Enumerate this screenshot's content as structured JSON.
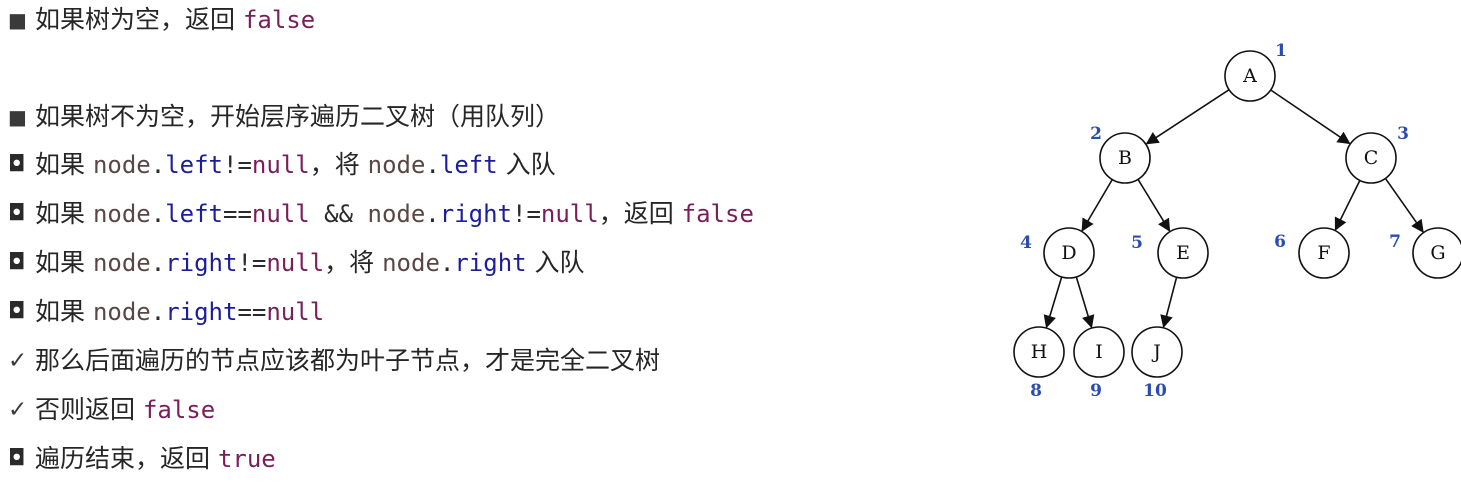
{
  "lines": [
    {
      "bullet": "■",
      "segments": [
        {
          "t": "如果树为空，返回 "
        },
        {
          "t": "false"
        }
      ]
    },
    {
      "bullet": "■",
      "segments": [
        {
          "t": "如果树不为空，开始层序遍历二叉树（用队列）"
        }
      ]
    },
    {
      "bullet": "◘",
      "segments": [
        {
          "t": "如果 "
        },
        {
          "t": "node"
        },
        {
          "t": "."
        },
        {
          "t": "left"
        },
        {
          "t": "!="
        },
        {
          "t": "null"
        },
        {
          "t": "，将 "
        },
        {
          "t": "node"
        },
        {
          "t": "."
        },
        {
          "t": "left"
        },
        {
          "t": " 入队"
        }
      ]
    },
    {
      "bullet": "◘",
      "segments": [
        {
          "t": "如果 "
        },
        {
          "t": "node"
        },
        {
          "t": "."
        },
        {
          "t": "left"
        },
        {
          "t": "=="
        },
        {
          "t": "null"
        },
        {
          "t": " && "
        },
        {
          "t": "node"
        },
        {
          "t": "."
        },
        {
          "t": "right"
        },
        {
          "t": "!="
        },
        {
          "t": "null"
        },
        {
          "t": "，返回 "
        },
        {
          "t": "false"
        }
      ]
    },
    {
      "bullet": "◘",
      "segments": [
        {
          "t": "如果 "
        },
        {
          "t": "node"
        },
        {
          "t": "."
        },
        {
          "t": "right"
        },
        {
          "t": "!="
        },
        {
          "t": "null"
        },
        {
          "t": "，将 "
        },
        {
          "t": "node"
        },
        {
          "t": "."
        },
        {
          "t": "right"
        },
        {
          "t": " 入队"
        }
      ]
    },
    {
      "bullet": "◘",
      "segments": [
        {
          "t": "如果 "
        },
        {
          "t": "node"
        },
        {
          "t": "."
        },
        {
          "t": "right"
        },
        {
          "t": "=="
        },
        {
          "t": "null"
        }
      ]
    },
    {
      "bullet": "✓",
      "segments": [
        {
          "t": "那么后面遍历的节点应该都为叶子节点，才是完全二叉树"
        }
      ]
    },
    {
      "bullet": "✓",
      "segments": [
        {
          "t": "否则返回 "
        },
        {
          "t": "false"
        }
      ]
    },
    {
      "bullet": "◘",
      "segments": [
        {
          "t": "遍历结束，返回 "
        },
        {
          "t": "true"
        }
      ]
    }
  ],
  "tree": {
    "nodes": [
      {
        "label": "A",
        "index": "1"
      },
      {
        "label": "B",
        "index": "2"
      },
      {
        "label": "C",
        "index": "3"
      },
      {
        "label": "D",
        "index": "4"
      },
      {
        "label": "E",
        "index": "5"
      },
      {
        "label": "F",
        "index": "6"
      },
      {
        "label": "G",
        "index": "7"
      },
      {
        "label": "H",
        "index": "8"
      },
      {
        "label": "I",
        "index": "9"
      },
      {
        "label": "J",
        "index": "10"
      }
    ],
    "edges": [
      [
        "A",
        "B"
      ],
      [
        "A",
        "C"
      ],
      [
        "B",
        "D"
      ],
      [
        "B",
        "E"
      ],
      [
        "C",
        "F"
      ],
      [
        "C",
        "G"
      ],
      [
        "D",
        "H"
      ],
      [
        "D",
        "I"
      ],
      [
        "E",
        "J"
      ]
    ],
    "colors": {
      "index": "#2a4bb0",
      "node_stroke": "#111111"
    }
  }
}
